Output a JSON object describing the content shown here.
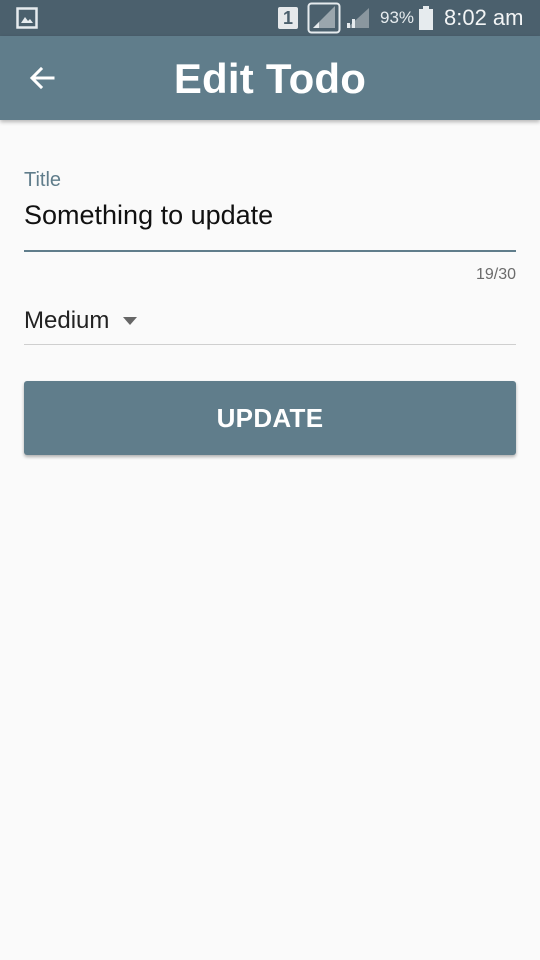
{
  "status_bar": {
    "sim_slot": "1",
    "battery_percent": "93%",
    "time": "8:02 am",
    "icons": [
      "gallery-icon",
      "sim-icon",
      "signal-icon",
      "signal-icon",
      "battery-icon"
    ]
  },
  "app_bar": {
    "title": "Edit Todo",
    "back_icon": "arrow-back-icon"
  },
  "form": {
    "title_label": "Title",
    "title_value": "Something to update",
    "char_counter": "19/30",
    "priority": {
      "selected": "Medium",
      "icon": "dropdown-arrow-icon"
    },
    "submit_label": "UPDATE"
  },
  "colors": {
    "status_bar": "#4b606d",
    "primary": "#607d8b",
    "background": "#fafafa"
  }
}
